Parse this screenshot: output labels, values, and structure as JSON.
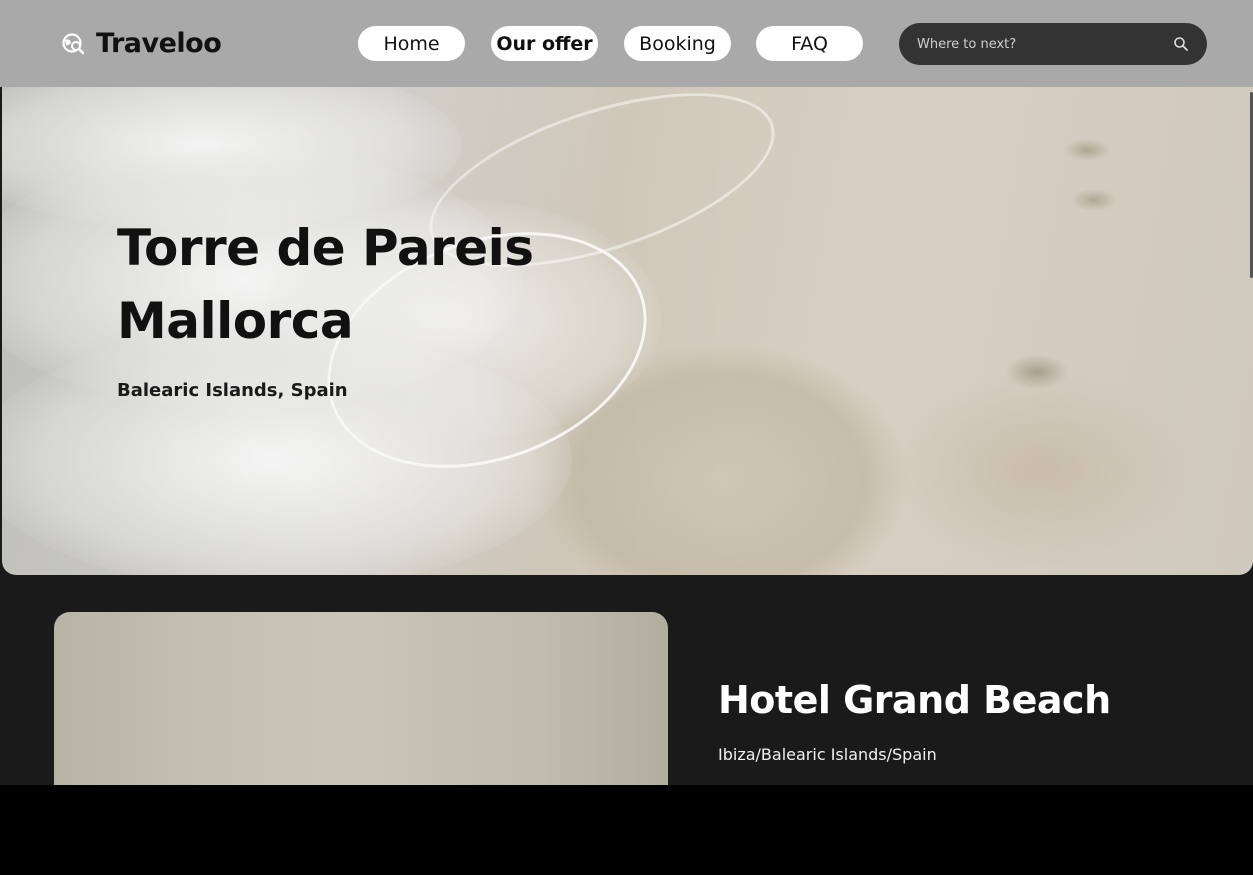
{
  "app": {
    "name": "Traveloo",
    "logo_icon": "globe-search-icon"
  },
  "nav": {
    "items": [
      {
        "label": "Home",
        "active": false
      },
      {
        "label": "Our offer",
        "active": true
      },
      {
        "label": "Booking",
        "active": false
      },
      {
        "label": "FAQ",
        "active": false
      }
    ]
  },
  "search": {
    "placeholder": "Where to next?",
    "value": "",
    "icon": "search-icon"
  },
  "hero": {
    "title_line1": "Torre de Pareis",
    "title_line2": "Mallorca",
    "subtitle": "Balearic Islands, Spain"
  },
  "hotel": {
    "name": "Hotel Grand Beach",
    "location": "Ibiza/Balearic Islands/Spain"
  },
  "colors": {
    "header_bg": "#a9a9a9",
    "page_bg": "#1a1a1a",
    "search_bg": "#333333",
    "nav_button_bg": "#ffffff"
  }
}
